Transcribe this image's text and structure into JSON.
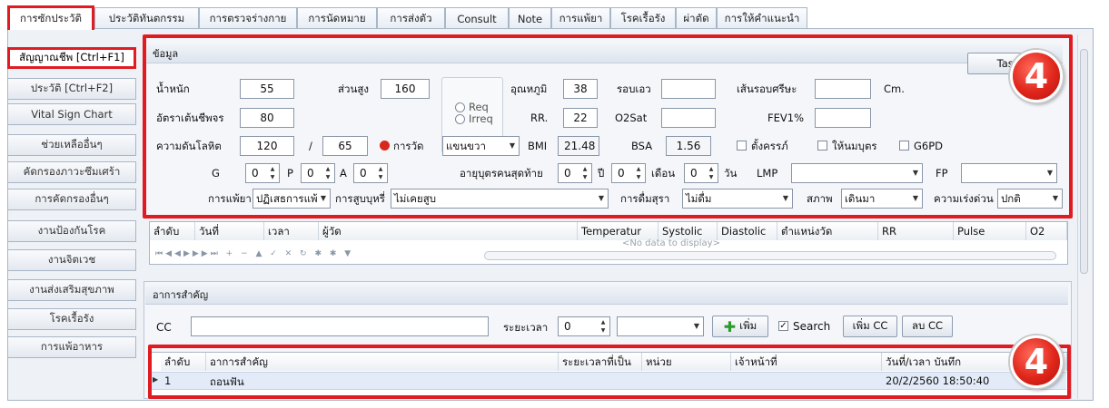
{
  "tabs": [
    "การซักประวัติ",
    "ประวัติทันตกรรม",
    "การตรวจร่างกาย",
    "การนัดหมาย",
    "การส่งตัว",
    "Consult",
    "Note",
    "การแพ้ยา",
    "โรคเรื้อรัง",
    "ผ่าตัด",
    "การให้คำแนะนำ"
  ],
  "sidebar": [
    "สัญญาณชีพ [Ctrl+F1]",
    "ประวัติ [Ctrl+F2]",
    "Vital Sign Chart",
    "ช่วยเหลืออื่นๆ",
    "คัดกรองภาวะซึมเศร้า",
    "การคัดกรองอื่นๆ",
    "งานป้องกันโรค",
    "งานจิตเวช",
    "งานส่งเสริมสุขภาพ",
    "โรคเรื้อรัง",
    "การแพ้อาหาร"
  ],
  "info": {
    "title": "ข้อมูล",
    "task_button": "Task",
    "weight_label": "น้ำหนัก",
    "weight": "55",
    "height_label": "ส่วนสูง",
    "height": "160",
    "temp_label": "อุณหภูมิ",
    "temp": "38",
    "waist_label": "รอบเอว",
    "waist": "",
    "head_label": "เส้นรอบศรีษะ",
    "head": "",
    "head_unit": "Cm.",
    "pulse_label": "อัตราเต้นชีพจร",
    "pulse": "80",
    "req_label": "Req",
    "irreq_label": "Irreq",
    "rr_label": "RR.",
    "rr": "22",
    "o2_label": "O2Sat",
    "o2": "",
    "fev_label": "FEV1%",
    "fev": "",
    "bp_label": "ความดันโลหิต",
    "bp_sys": "120",
    "bp_slash": "/",
    "bp_dia": "65",
    "measure_button": "การวัด",
    "arm": "แขนขวา",
    "bmi_label": "BMI",
    "bmi": "21.48",
    "bsa_label": "BSA",
    "bsa": "1.56",
    "pregnant_label": "ตั้งครรภ์",
    "breastfeed_label": "ให้นมบุตร",
    "g6pd_label": "G6PD",
    "g_label": "G",
    "g": "0",
    "p_label": "P",
    "p": "0",
    "a_label": "A",
    "a": "0",
    "last_child_age_label": "อายุบุตรคนสุดท้าย",
    "year_val": "0",
    "year_label": "ปี",
    "month_val": "0",
    "month_label": "เดือน",
    "day_val": "0",
    "day_label": "วัน",
    "lmp_label": "LMP",
    "lmp": "",
    "fp_label": "FP",
    "fp": "",
    "allergy_label": "การแพ้ยา",
    "allergy": "ปฏิเสธการแพ้",
    "smoke_label": "การสูบบุหรี่",
    "smoke": "ไม่เคยสูบ",
    "drink_label": "การดื่มสุรา",
    "drink": "ไม่ดื่ม",
    "status_label": "สภาพ",
    "status": "เดินมา",
    "urgency_label": "ความเร่งด่วน",
    "urgency": "ปกติ"
  },
  "vitals_grid": {
    "columns": [
      "ลำดับ",
      "วันที่",
      "เวลา",
      "ผู้วัด",
      "Temperatur",
      "Systolic",
      "Diastolic",
      "ตำแหน่งวัด",
      "RR",
      "Pulse",
      "O2"
    ],
    "empty_text": "<No data to display>"
  },
  "symptoms": {
    "title": "อาการสำคัญ",
    "cc_label": "CC",
    "cc": "",
    "duration_label": "ระยะเวลา",
    "duration": "0",
    "unit": "",
    "add_button": "เพิ่ม",
    "search_label": "Search",
    "add_cc_button": "เพิ่ม CC",
    "del_cc_button": "ลบ CC",
    "columns": [
      "ลำดับ",
      "อาการสำคัญ",
      "ระยะเวลาที่เป็น",
      "หน่วย",
      "เจ้าหน้าที่",
      "วันที่/เวลา บันทึก"
    ],
    "rows": [
      [
        "1",
        "ถอนฟัน",
        "",
        "",
        "",
        "20/2/2560 18:50:40"
      ]
    ]
  },
  "badge_number": "4",
  "colors": {
    "highlight": "#e01b22",
    "accent": "#2a6bd1"
  }
}
